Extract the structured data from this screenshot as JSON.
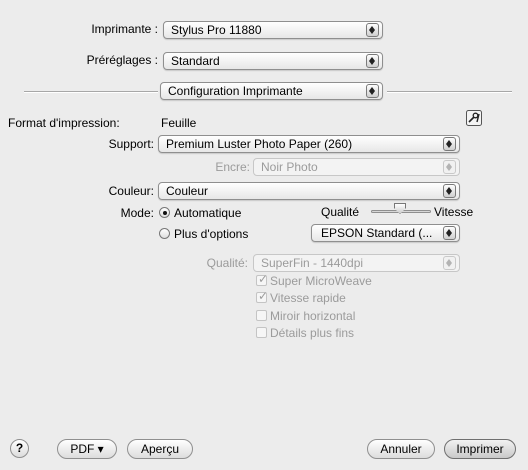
{
  "printer": {
    "label": "Imprimante :",
    "value": "Stylus Pro 11880"
  },
  "presets": {
    "label": "Préréglages :",
    "value": "Standard"
  },
  "panel": {
    "value": "Configuration Imprimante"
  },
  "page_format": {
    "label": "Format d'impression:",
    "value": "Feuille"
  },
  "support": {
    "label": "Support:",
    "value": "Premium Luster Photo Paper (260)"
  },
  "ink": {
    "label": "Encre:",
    "value": "Noir Photo"
  },
  "color": {
    "label": "Couleur:",
    "value": "Couleur"
  },
  "mode": {
    "label": "Mode:",
    "automatic_label": "Automatique",
    "more_label": "Plus d'options",
    "selected": "Automatique",
    "slider_left": "Qualité",
    "slider_right": "Vitesse",
    "options_value": "EPSON Standard (..."
  },
  "quality": {
    "label": "Qualité:",
    "value": "SuperFin - 1440dpi"
  },
  "options": [
    {
      "label": "Super MicroWeave",
      "checked": true
    },
    {
      "label": "Vitesse rapide",
      "checked": true
    },
    {
      "label": "Miroir horizontal",
      "checked": false
    },
    {
      "label": "Détails plus fins",
      "checked": false
    }
  ],
  "footer": {
    "help": "?",
    "pdf": "PDF ▾",
    "preview": "Aperçu",
    "cancel": "Annuler",
    "print": "Imprimer"
  },
  "icons": {
    "utility": "printer-utility-icon"
  }
}
